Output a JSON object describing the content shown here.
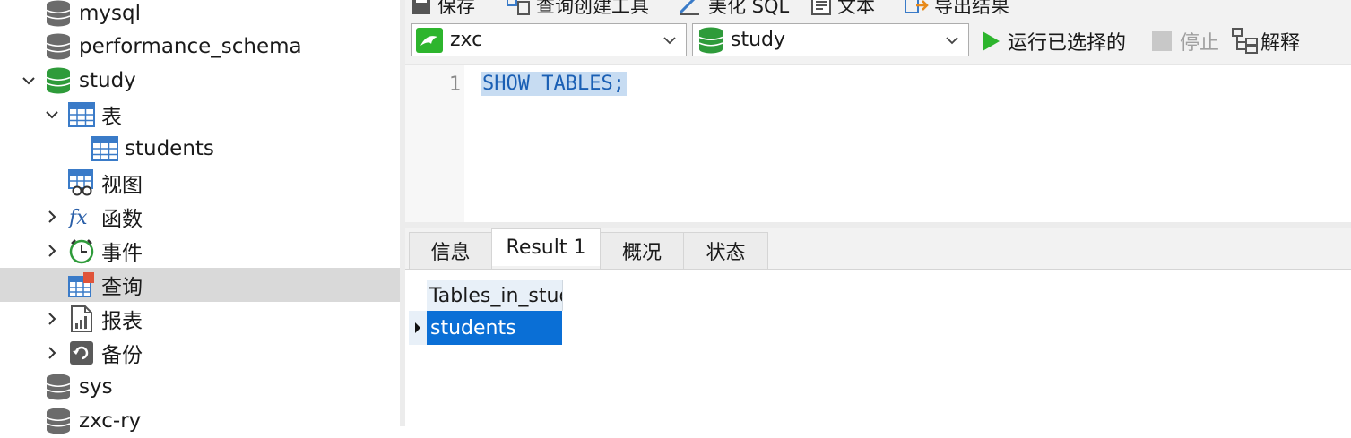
{
  "navigator": {
    "items": [
      {
        "label": "mysql",
        "icon": "database-icon"
      },
      {
        "label": "performance_schema",
        "icon": "database-icon"
      },
      {
        "label": "study",
        "icon": "database-open-icon",
        "expanded": true
      },
      {
        "label": "表",
        "icon": "table-icon",
        "expanded": true
      },
      {
        "label": "students",
        "icon": "table-icon"
      },
      {
        "label": "视图",
        "icon": "view-icon"
      },
      {
        "label": "函数",
        "icon": "function-icon"
      },
      {
        "label": "事件",
        "icon": "event-clock-icon"
      },
      {
        "label": "查询",
        "icon": "query-icon",
        "selected": true
      },
      {
        "label": "报表",
        "icon": "report-icon"
      },
      {
        "label": "备份",
        "icon": "backup-icon"
      },
      {
        "label": "sys",
        "icon": "database-icon"
      },
      {
        "label": "zxc-ry",
        "icon": "database-icon"
      }
    ]
  },
  "toolbar": {
    "save_label": "保存",
    "query_builder_label": "查询创建工具",
    "beautify_label": "美化 SQL",
    "text_label": "文本",
    "export_label": "导出结果",
    "connection_value": "zxc",
    "database_value": "study",
    "run_selected_label": "运行已选择的",
    "stop_label": "停止",
    "explain_label": "解释"
  },
  "editor": {
    "line_number": "1",
    "code": "SHOW TABLES;"
  },
  "result_tabs": [
    {
      "label": "信息"
    },
    {
      "label": "Result 1",
      "active": true
    },
    {
      "label": "概况"
    },
    {
      "label": "状态"
    }
  ],
  "result_grid": {
    "column_header": "Tables_in_study",
    "rows": [
      "students"
    ]
  },
  "colors": {
    "db_green": "#2e9b3a",
    "selection_blue": "#0a6fd6",
    "run_green": "#2db52d",
    "code_blue": "#1a5fb4"
  }
}
